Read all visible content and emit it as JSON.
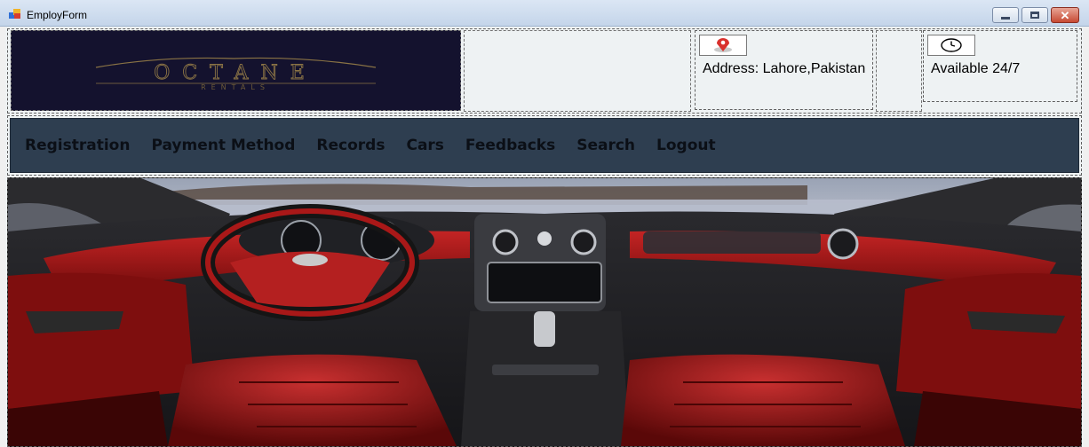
{
  "window": {
    "title": "EmployForm",
    "controls": {
      "minimize": "minimize-icon",
      "maximize": "maximize-icon",
      "close": "close-icon"
    }
  },
  "header": {
    "logo": {
      "brand": "OCTANE",
      "sub": "RENTALS"
    },
    "address": {
      "icon": "location-pin-icon",
      "text": "Address: Lahore,Pakistan"
    },
    "availability": {
      "icon": "clock-icon",
      "text": "Available 24/7"
    }
  },
  "menu": {
    "items": [
      {
        "label": "Registration"
      },
      {
        "label": "Payment Method"
      },
      {
        "label": "Records"
      },
      {
        "label": "Cars"
      },
      {
        "label": "Feedbacks"
      },
      {
        "label": "Search"
      },
      {
        "label": "Logout"
      }
    ]
  },
  "hero": {
    "image": "red-luxury-car-interior-photo"
  },
  "colors": {
    "menu_bg": "#2e3e50",
    "logo_bg": "#14122e",
    "logo_gold": "#8a7345",
    "upholstery_red": "#b01a1a"
  }
}
